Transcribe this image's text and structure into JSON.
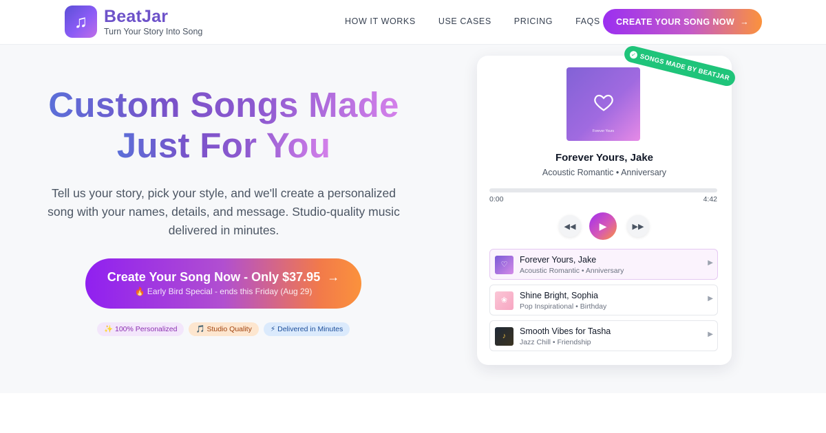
{
  "header": {
    "brand_name": "BeatJar",
    "brand_tagline": "Turn Your Story Into Song",
    "nav": [
      "HOW IT WORKS",
      "USE CASES",
      "PRICING",
      "FAQS"
    ],
    "cta_label": "CREATE YOUR SONG NOW",
    "cta_icon": "arrow-right-icon"
  },
  "hero": {
    "headline_line1": "Custom Songs Made",
    "headline_line2": "Just For You",
    "subheadline": "Tell us your story, pick your style, and we'll create a personalized song with your names, details, and message. Studio-quality music delivered in minutes.",
    "cta_label": "Create Your Song Now - Only $37.95",
    "cta_sublabel": "🔥 Early Bird Special - ends this Friday (Aug 29)",
    "badges": [
      "✨ 100% Personalized",
      "🎵 Studio Quality",
      "⚡ Delivered in Minutes"
    ]
  },
  "player": {
    "ribbon": "SONGS MADE BY BEATJAR",
    "cover_title": "Forever Yours",
    "now_playing_title": "Forever Yours, Jake",
    "now_playing_meta": "Acoustic Romantic • Anniversary",
    "time_current": "0:00",
    "time_total": "4:42",
    "progress": 0,
    "tracks": [
      {
        "title": "Forever Yours, Jake",
        "meta": "Acoustic Romantic • Anniversary",
        "active": true
      },
      {
        "title": "Shine Bright, Sophia",
        "meta": "Pop Inspirational • Birthday",
        "active": false
      },
      {
        "title": "Smooth Vibes for Tasha",
        "meta": "Jazz Chill • Friendship",
        "active": false
      }
    ]
  },
  "colors": {
    "brand_purple": "#6d52c9",
    "cta_gradient_start": "#9b2ff0",
    "cta_gradient_end": "#fb923c",
    "ribbon_green": "#1fc47a"
  }
}
